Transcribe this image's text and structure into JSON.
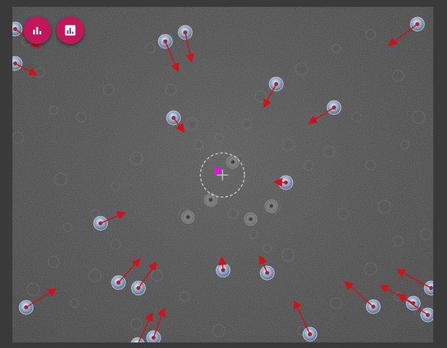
{
  "toolbar": {
    "buttons": [
      {
        "icon": "bar-chart-icon"
      },
      {
        "icon": "analytics-report-icon"
      }
    ]
  },
  "theme": {
    "background": "#3a3a3a",
    "button_color": "#c2185b",
    "vector_color": "#d0101a",
    "target_color": "#ff00ff"
  }
}
